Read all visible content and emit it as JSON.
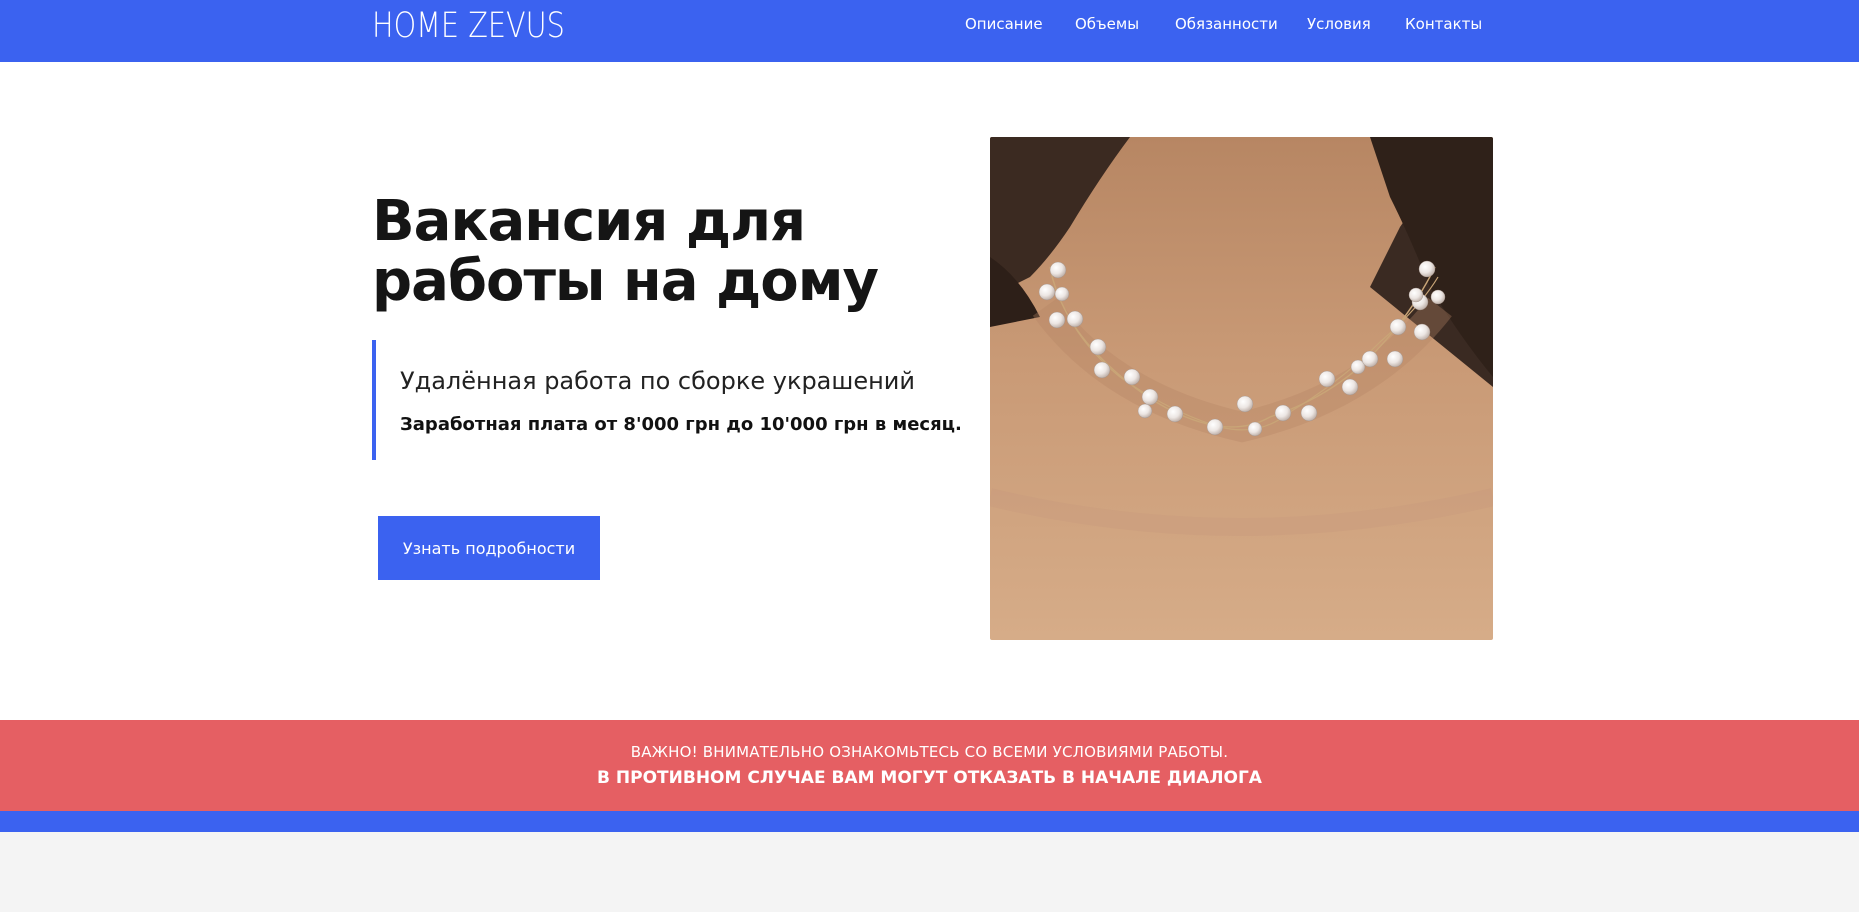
{
  "header": {
    "logo": "HOME ZEVUS",
    "nav": [
      "Описание",
      "Объемы",
      "Обязанности",
      "Условия",
      "Контакты"
    ]
  },
  "hero": {
    "title_line1": "Вакансия для",
    "title_line2": "работы на дому",
    "subtitle": "Удалённая работа по сборке украшений",
    "salary": "Заработная плата от 8'000 грн до 10'000 грн в месяц.",
    "cta_label": "Узнать подробности"
  },
  "notice": {
    "line1": "ВАЖНО!  ВНИМАТЕЛЬНО ОЗНАКОМЬТЕСЬ СО ВСЕМИ УСЛОВИЯМИ РАБОТЫ.",
    "line2": "В ПРОТИВНОМ СЛУЧАЕ ВАМ МОГУТ ОТКАЗАТЬ В НАЧАЛЕ ДИАЛОГА"
  },
  "colors": {
    "accent": "#3b62f0",
    "notice": "#e55f63",
    "footer_bg": "#f4f4f4"
  }
}
